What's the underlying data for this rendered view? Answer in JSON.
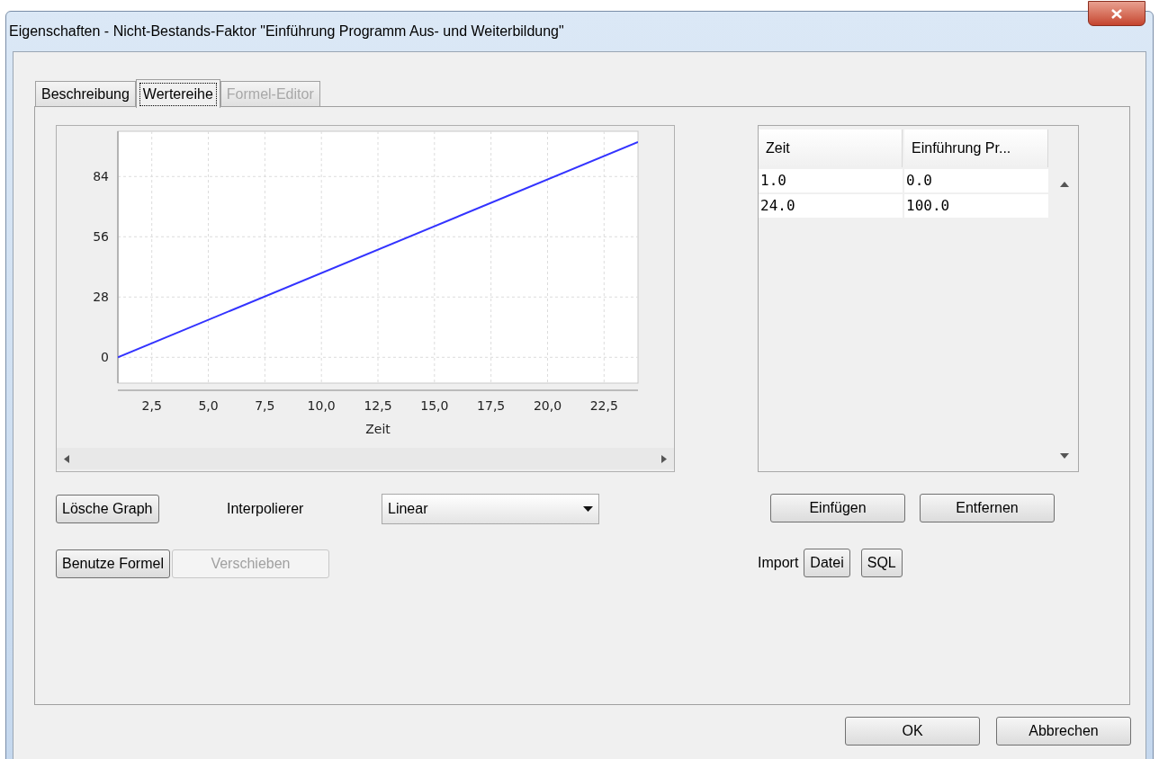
{
  "window": {
    "title": "Eigenschaften - Nicht-Bestands-Faktor \"Einführung Programm Aus- und Weiterbildung\""
  },
  "tabs": [
    {
      "label": "Beschreibung",
      "selected": false,
      "disabled": false
    },
    {
      "label": "Wertereihe",
      "selected": true,
      "disabled": false
    },
    {
      "label": "Formel-Editor",
      "selected": false,
      "disabled": true
    }
  ],
  "chart": {
    "chart_data": {
      "type": "line",
      "xlabel": "Zeit",
      "x": [
        1.0,
        24.0
      ],
      "series": [
        {
          "color": "#3333ff",
          "values": [
            0.0,
            100.0
          ]
        }
      ],
      "xlim": [
        1.0,
        24.0
      ],
      "ylim": [
        -12,
        105
      ],
      "xticks": [
        {
          "value": 2.5,
          "label": "2,5"
        },
        {
          "value": 5,
          "label": "5,0"
        },
        {
          "value": 7.5,
          "label": "7,5"
        },
        {
          "value": 10,
          "label": "10,0"
        },
        {
          "value": 12.5,
          "label": "12,5"
        },
        {
          "value": 15,
          "label": "15,0"
        },
        {
          "value": 17.5,
          "label": "17,5"
        },
        {
          "value": 20,
          "label": "20,0"
        },
        {
          "value": 22.5,
          "label": "22,5"
        }
      ],
      "yticks": [
        0,
        28,
        56,
        84
      ],
      "grid": true
    }
  },
  "table": {
    "columns": [
      "Zeit",
      "Einführung Pr..."
    ],
    "rows": [
      [
        "1.0",
        "0.0"
      ],
      [
        "24.0",
        "100.0"
      ]
    ]
  },
  "graph_buttons": [
    {
      "label": "Lösche Graph",
      "disabled": false
    }
  ],
  "interpolator": {
    "label": "Interpolierer",
    "value": "Linear"
  },
  "formula_buttons": [
    {
      "label": "Benutze Formel",
      "disabled": false
    },
    {
      "label": "Verschieben",
      "disabled": true
    }
  ],
  "table_buttons": [
    {
      "label": "Einfügen",
      "disabled": false
    },
    {
      "label": "Entfernen",
      "disabled": false
    }
  ],
  "import": {
    "label": "Import",
    "buttons": [
      {
        "label": "Datei",
        "disabled": false
      },
      {
        "label": "SQL",
        "disabled": false
      }
    ]
  },
  "dialog_buttons": [
    {
      "label": "OK",
      "disabled": false
    },
    {
      "label": "Abbrechen",
      "disabled": false
    }
  ]
}
